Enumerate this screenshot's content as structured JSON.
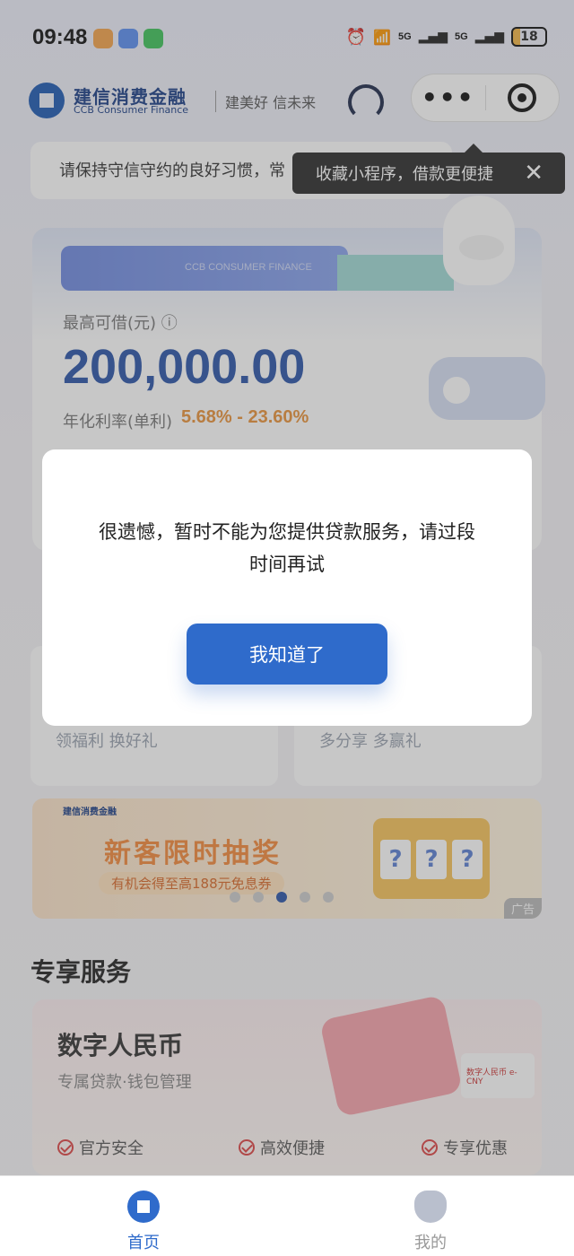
{
  "status_bar": {
    "time": "09:48",
    "signal_1": "5G",
    "signal_2": "5G",
    "battery": "18"
  },
  "header": {
    "brand_cn": "建信消费金融",
    "brand_en": "CCB Consumer Finance",
    "slogan": "建美好 信未来",
    "more_label": "•••"
  },
  "notice": {
    "text": "请保持守信守约的良好习惯，常"
  },
  "tooltip": {
    "text": "收藏小程序，借款更便捷",
    "close": "✕"
  },
  "credit": {
    "card_en": "CCB CONSUMER FINANCE",
    "label": "最高可借(元)",
    "info_icon": "ⓘ",
    "amount": "200,000.00",
    "rate_label": "年化利率(单利)",
    "rate_value": "5.68% - 23.60%"
  },
  "promos": {
    "left": "领福利 换好礼",
    "right": "多分享 多赢礼"
  },
  "banner": {
    "brand": "建信消费金融",
    "title": "新客限时抽奖",
    "subtitle": "有机会得至高188元免息券",
    "ad_tag": "广告",
    "slot": [
      "?",
      "?",
      "?"
    ]
  },
  "services": {
    "title": "专享服务",
    "card_name": "数字人民币",
    "card_desc": "专属贷款·钱包管理",
    "ecny_label": "数字人民币 e-CNY",
    "features": [
      "官方安全",
      "高效便捷",
      "专享优惠"
    ]
  },
  "modal": {
    "message": "很遗憾，暂时不能为您提供贷款服务，请过段时间再试",
    "button": "我知道了"
  },
  "bottom_nav": {
    "home": "首页",
    "mine": "我的"
  },
  "colors": {
    "brand_blue": "#2f6bcb",
    "amount_blue": "#2c55a8",
    "rate_orange": "#e9923a"
  }
}
